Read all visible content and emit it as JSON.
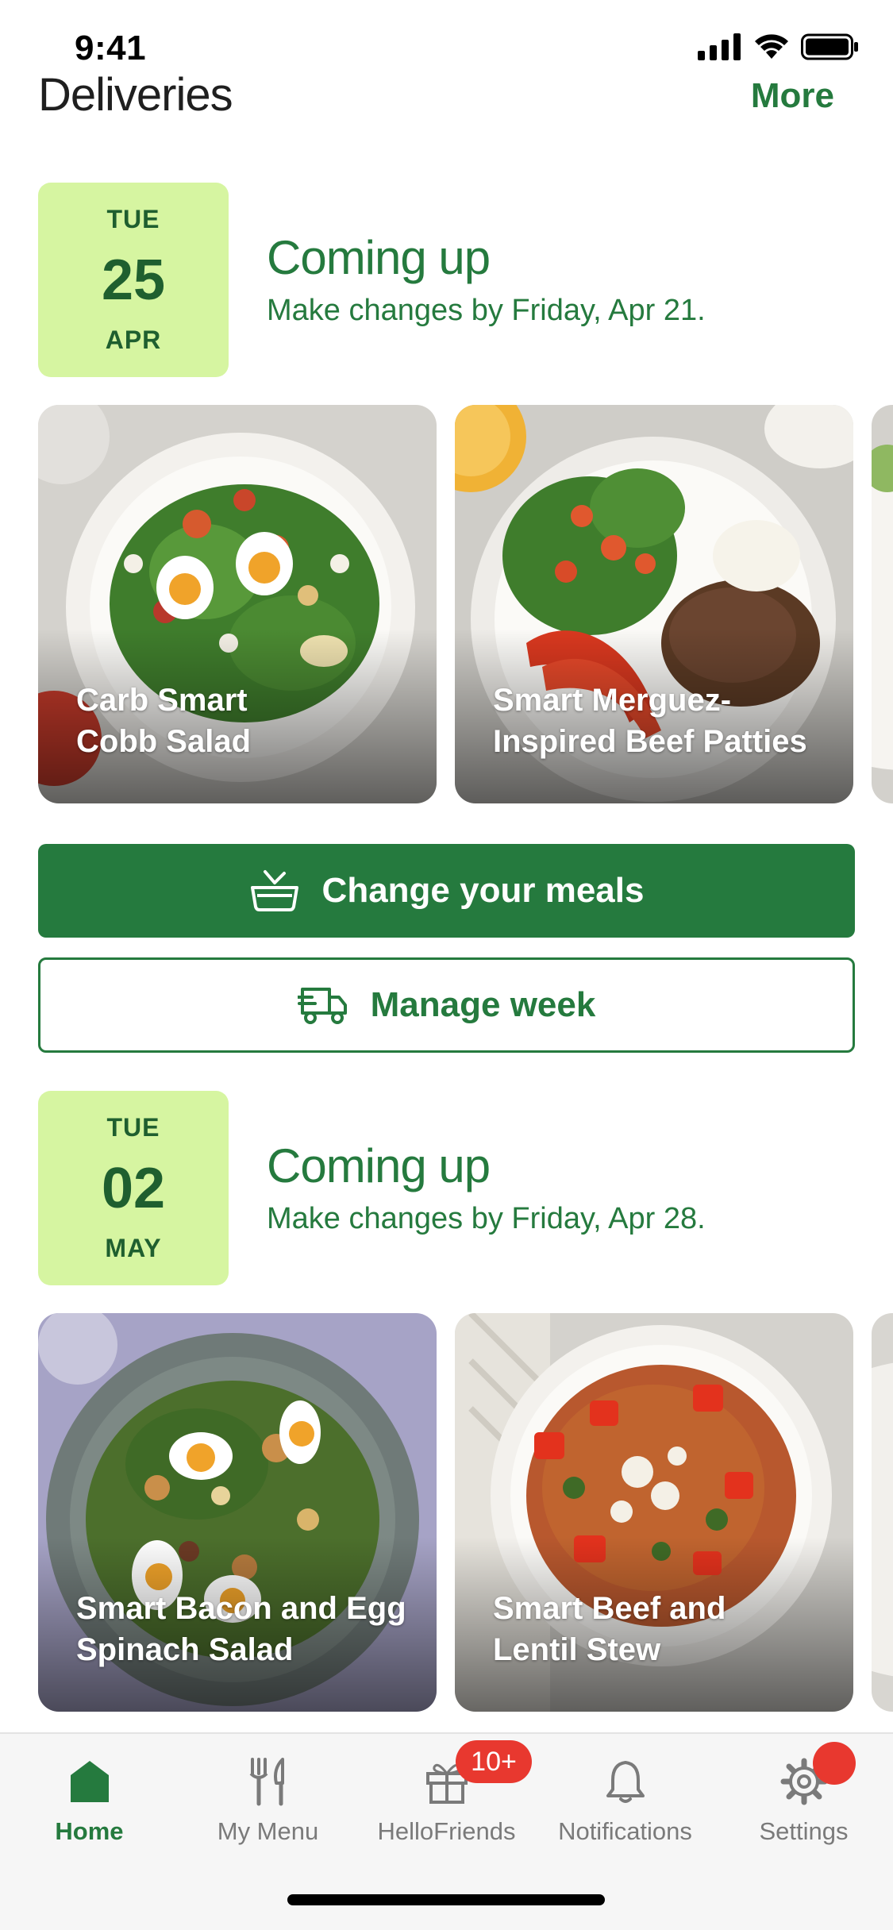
{
  "status_bar": {
    "time": "9:41"
  },
  "header": {
    "title": "Deliveries",
    "more_label": "More"
  },
  "deliveries": [
    {
      "date": {
        "dow": "TUE",
        "day": "25",
        "month": "APR"
      },
      "heading": "Coming up",
      "subheading": "Make changes by Friday, Apr 21.",
      "meals": [
        {
          "line1": "Carb Smart",
          "line2": "Cobb Salad"
        },
        {
          "line1": "Smart Merguez-",
          "line2": "Inspired Beef Patties"
        }
      ]
    },
    {
      "date": {
        "dow": "TUE",
        "day": "02",
        "month": "MAY"
      },
      "heading": "Coming up",
      "subheading": "Make changes by Friday, Apr 28.",
      "meals": [
        {
          "line1": "Smart Bacon and Egg",
          "line2": "Spinach Salad"
        },
        {
          "line1": "Smart Beef and",
          "line2": "Lentil Stew"
        }
      ]
    }
  ],
  "actions": {
    "change_meals_label": "Change your meals",
    "manage_week_label": "Manage week"
  },
  "tab_bar": {
    "items": [
      {
        "label": "Home",
        "icon": "home-icon",
        "active": true
      },
      {
        "label": "My Menu",
        "icon": "fork-knife-icon"
      },
      {
        "label": "HelloFriends",
        "icon": "gift-icon",
        "badge": "10+"
      },
      {
        "label": "Notifications",
        "icon": "bell-icon"
      },
      {
        "label": "Settings",
        "icon": "gear-icon",
        "dot": true
      }
    ]
  },
  "colors": {
    "brand_green": "#257a3e",
    "date_badge_bg": "#d6f5a1",
    "badge_red": "#e8382f"
  }
}
